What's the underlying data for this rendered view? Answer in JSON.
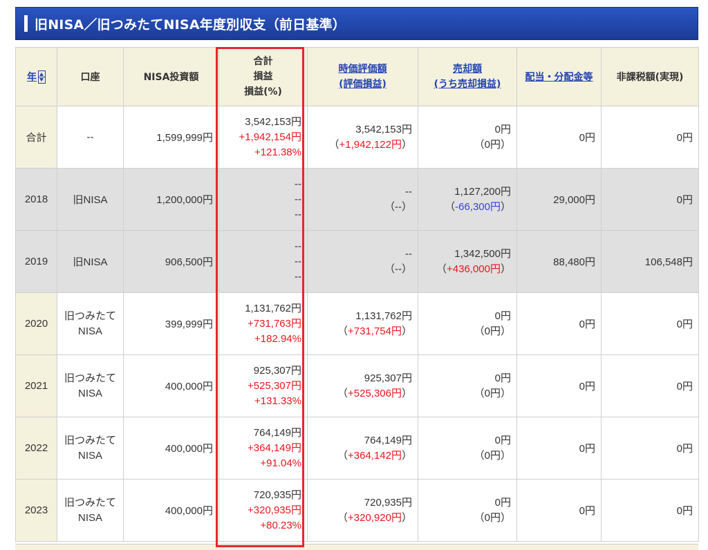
{
  "title": "旧NISA／旧つみたてNISA年度別収支（前日基準）",
  "headers": {
    "year": "年",
    "account": "口座",
    "invest": "NISA投資額",
    "total_line1": "合計",
    "total_line2": "損益",
    "total_line3": "損益(%)",
    "market_line1": "時価評価額",
    "market_line2": "(評価損益)",
    "sale_line1": "売却額",
    "sale_line2": "(うち売却損益)",
    "dividend": "配当・分配金等",
    "taxfree": "非課税額(実現)"
  },
  "rows": [
    {
      "year": "合計",
      "account": "--",
      "invest": "1,599,999円",
      "total": "3,542,153円",
      "pl": "+1,942,154円",
      "pct": "+121.38%",
      "market": "3,542,153円",
      "market_pl": "+1,942,122円",
      "sale": "0円",
      "sale_pl": "0円",
      "dividend": "0円",
      "taxfree": "0円"
    },
    {
      "year": "2018",
      "account": "旧NISA",
      "invest": "1,200,000円",
      "total": "--",
      "pl": "--",
      "pct": "--",
      "market": "--",
      "market_pl": "--",
      "sale": "1,127,200円",
      "sale_pl": "-66,300円",
      "dividend": "29,000円",
      "taxfree": "0円"
    },
    {
      "year": "2019",
      "account": "旧NISA",
      "invest": "906,500円",
      "total": "--",
      "pl": "--",
      "pct": "--",
      "market": "--",
      "market_pl": "--",
      "sale": "1,342,500円",
      "sale_pl": "+436,000円",
      "dividend": "88,480円",
      "taxfree": "106,548円"
    },
    {
      "year": "2020",
      "account_line1": "旧つみたて",
      "account_line2": "NISA",
      "invest": "399,999円",
      "total": "1,131,762円",
      "pl": "+731,763円",
      "pct": "+182.94%",
      "market": "1,131,762円",
      "market_pl": "+731,754円",
      "sale": "0円",
      "sale_pl": "0円",
      "dividend": "0円",
      "taxfree": "0円"
    },
    {
      "year": "2021",
      "account_line1": "旧つみたて",
      "account_line2": "NISA",
      "invest": "400,000円",
      "total": "925,307円",
      "pl": "+525,307円",
      "pct": "+131.33%",
      "market": "925,307円",
      "market_pl": "+525,306円",
      "sale": "0円",
      "sale_pl": "0円",
      "dividend": "0円",
      "taxfree": "0円"
    },
    {
      "year": "2022",
      "account_line1": "旧つみたて",
      "account_line2": "NISA",
      "invest": "400,000円",
      "total": "764,149円",
      "pl": "+364,149円",
      "pct": "+91.04%",
      "market": "764,149円",
      "market_pl": "+364,142円",
      "sale": "0円",
      "sale_pl": "0円",
      "dividend": "0円",
      "taxfree": "0円"
    },
    {
      "year": "2023",
      "account_line1": "旧つみたて",
      "account_line2": "NISA",
      "invest": "400,000円",
      "total": "720,935円",
      "pl": "+320,935円",
      "pct": "+80.23%",
      "market": "720,935円",
      "market_pl": "+320,920円",
      "sale": "0円",
      "sale_pl": "0円",
      "dividend": "0円",
      "taxfree": "0円"
    }
  ],
  "colors": {
    "header_bg": "#f4f1dd",
    "title_bar": "#1f43a8",
    "positive": "#e8161c",
    "negative": "#3640e6",
    "link": "#2343b0",
    "highlight": "#e8262c"
  }
}
